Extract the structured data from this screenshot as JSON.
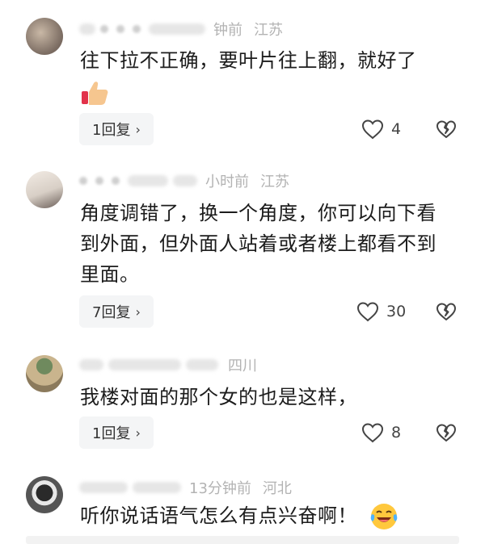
{
  "comments": [
    {
      "time": "钟前",
      "location": "江苏",
      "text": "往下拉不正确，要叶片往上翻，就好了",
      "reply_label": "1回复",
      "likes": "4",
      "emoji_icon": "thumbs-up-icon"
    },
    {
      "time": "小时前",
      "location": "江苏",
      "text": "角度调错了，换一个角度，你可以向下看到外面，但外面人站着或者楼上都看不到里面。",
      "reply_label": "7回复",
      "likes": "30"
    },
    {
      "time": "",
      "location": "四川",
      "text": "我楼对面的那个女的也是这样，",
      "reply_label": "1回复",
      "likes": "8"
    },
    {
      "time": "13分钟前",
      "location": "河北",
      "text": "听你说话语气怎么有点兴奋啊！",
      "emoji_icon": "laughing-tears-icon"
    }
  ],
  "reply_chevron": "›",
  "colors": {
    "text": "#1c1c1c",
    "meta": "#b3b3b3",
    "button_bg": "#f4f5f6"
  }
}
